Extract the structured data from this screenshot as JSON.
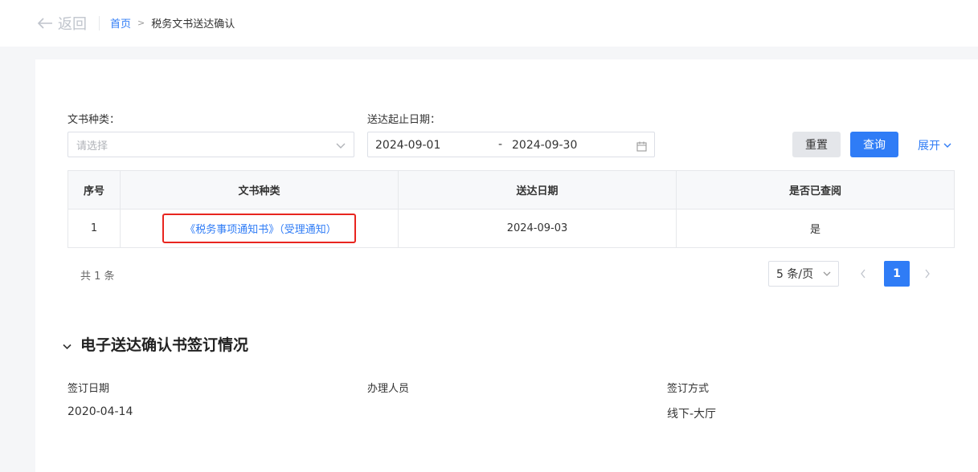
{
  "header": {
    "back_label": "返回",
    "breadcrumb": {
      "home": "首页",
      "separator": ">",
      "current": "税务文书送达确认"
    }
  },
  "filters": {
    "doc_type_label": "文书种类：",
    "doc_type_placeholder": "请选择",
    "date_range_label": "送达起止日期：",
    "date_start": "2024-09-01",
    "date_sep": "-",
    "date_end": "2024-09-30",
    "reset_label": "重置",
    "query_label": "查询",
    "expand_label": "展开"
  },
  "table": {
    "columns": [
      "序号",
      "文书种类",
      "送达日期",
      "是否已查阅"
    ],
    "rows": [
      {
        "index": "1",
        "doc_type": "《税务事项通知书》（受理通知）",
        "date": "2024-09-03",
        "viewed": "是"
      }
    ]
  },
  "pagination": {
    "total": "共 1 条",
    "page_size": "5 条/页",
    "current_page": "1"
  },
  "section": {
    "title": "电子送达确认书签订情况",
    "sign_date_label": "签订日期",
    "sign_date": "2020-04-14",
    "handler_label": "办理人员",
    "method_label": "签订方式",
    "method": "线下-大厅"
  },
  "colors": {
    "primary": "#2f7cf6",
    "highlight_border": "#e8251f"
  }
}
